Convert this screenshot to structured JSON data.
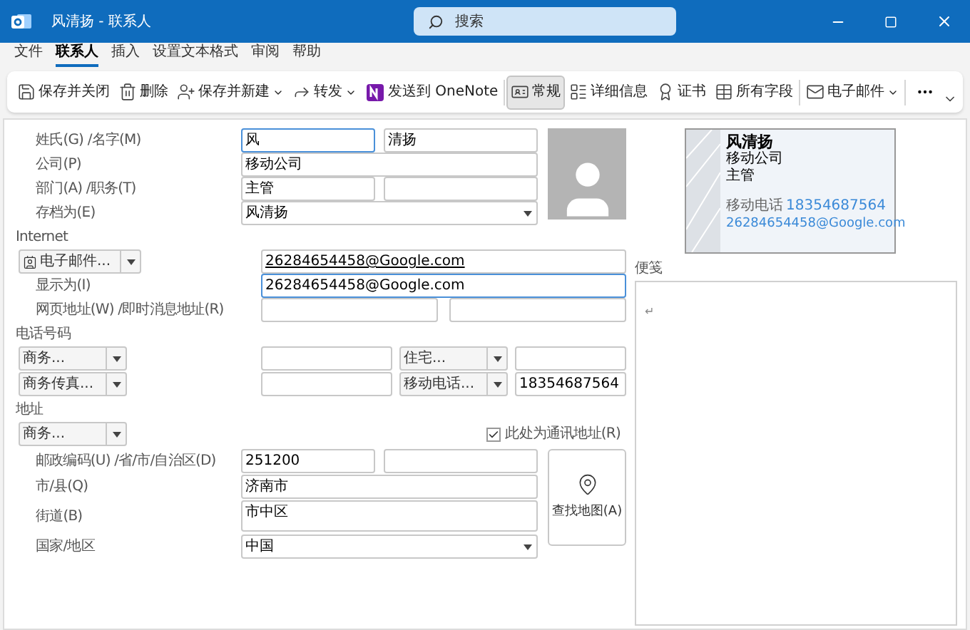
{
  "window": {
    "title": "风清扬 - 联系人"
  },
  "search": {
    "placeholder": "搜索"
  },
  "menu_tabs": [
    {
      "label": "文件",
      "selected": false
    },
    {
      "label": "联系人",
      "selected": true
    },
    {
      "label": "插入",
      "selected": false
    },
    {
      "label": "设置文本格式",
      "selected": false
    },
    {
      "label": "审阅",
      "selected": false
    },
    {
      "label": "帮助",
      "selected": false
    }
  ],
  "ribbon": [
    {
      "label": "保存并关闭",
      "kind": "save-close",
      "dropdown": false,
      "selected": false
    },
    {
      "label": "删除",
      "kind": "delete",
      "dropdown": false,
      "selected": false
    },
    {
      "label": "保存并新建",
      "kind": "save-new",
      "dropdown": true,
      "selected": false
    },
    {
      "label": "转发",
      "kind": "forward",
      "dropdown": true,
      "selected": false
    },
    {
      "label": "发送到 OneNote",
      "kind": "onenote",
      "dropdown": false,
      "selected": false
    },
    {
      "label": "常规",
      "kind": "general",
      "dropdown": false,
      "selected": true
    },
    {
      "label": "详细信息",
      "kind": "details",
      "dropdown": false,
      "selected": false
    },
    {
      "label": "证书",
      "kind": "certificate",
      "dropdown": false,
      "selected": false
    },
    {
      "label": "所有字段",
      "kind": "fields",
      "dropdown": false,
      "selected": false
    },
    {
      "label": "电子邮件",
      "kind": "email",
      "dropdown": true,
      "selected": false
    }
  ],
  "form": {
    "name_label": "姓氏(G) /名字(M)",
    "last_name": "风",
    "first_name": "清扬",
    "company_label": "公司(P)",
    "company": "移动公司",
    "dept_label": "部门(A) /职务(T)",
    "department": "主管",
    "file_as_label": "存档为(E)",
    "file_as": "风清扬",
    "internet_header": "Internet",
    "email_type": "电子邮件...",
    "email": "26284654458@Google.com",
    "display_as_label": "显示为(I)",
    "display_as": "26284654458@Google.com",
    "web_label": "网页地址(W) /即时消息地址(R)",
    "phone_header": "电话号码",
    "phones": [
      {
        "type": "商务..."
      },
      {
        "type": "住宅..."
      },
      {
        "type": "商务传真..."
      },
      {
        "type": "移动电话...",
        "number": "18354687564"
      }
    ],
    "address_header": "地址",
    "address_type": "商务...",
    "mailing_checkbox": {
      "label": "此处为通讯地址(R)",
      "checked": true
    },
    "postal_label": "邮政编码(U) /省/市/自治区(D)",
    "postal_code": "251200",
    "city_label": "市/县(Q)",
    "city": "济南市",
    "street_label": "街道(B)",
    "street": "市中区",
    "country_label": "国家/地区",
    "country": "中国",
    "map_button": "查找地图(A)"
  },
  "business_card": {
    "name": "风清扬",
    "company": "移动公司",
    "title": "主管",
    "phone_label": "移动电话",
    "phone": "18354687564",
    "email": "26284654458@Google.com"
  },
  "notes": {
    "label": "便笺",
    "content": "↵"
  }
}
